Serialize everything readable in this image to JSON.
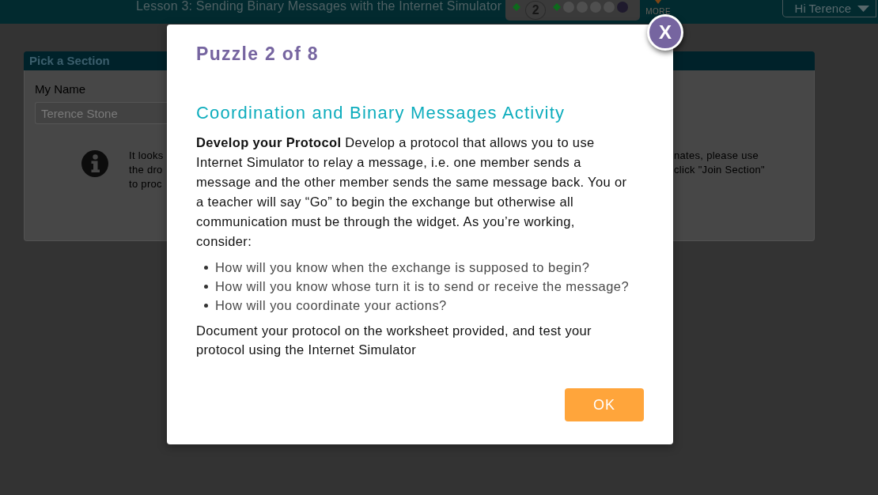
{
  "header": {
    "lesson_title": "Lesson 3: Sending Binary Messages with the Internet Simulator",
    "progress": [
      {
        "kind": "diamond",
        "color": "#0d6a1c"
      },
      {
        "kind": "bubble",
        "label": "2"
      },
      {
        "kind": "diamond",
        "color": "#0d6a1c"
      },
      {
        "kind": "dot",
        "color": "#4f4f4f"
      },
      {
        "kind": "dot",
        "color": "#4f4f4f"
      },
      {
        "kind": "dot",
        "color": "#4f4f4f"
      },
      {
        "kind": "dot",
        "color": "#4f4f4f"
      },
      {
        "kind": "dot",
        "color": "#1f1a2d"
      }
    ],
    "more_label": "MORE",
    "user_menu": "Hi Terence"
  },
  "section_card": {
    "title": "Pick a Section",
    "name_label": "My Name",
    "name_value": "Terence Stone",
    "info_text_left": [
      "It looks",
      "the dro",
      "to proc"
    ],
    "info_text_right": [
      "nates, please use",
      "click \"Join Section\""
    ]
  },
  "dialog": {
    "title": "Puzzle 2 of 8",
    "close_label": "X",
    "heading": "Coordination and Binary Messages Activity",
    "intro": "**Develop your Protocol** Develop a protocol that allows you to use Internet Simulator to relay a message, i.e. one member sends a message and the other member sends the same message back. You or a teacher will say “Go” to begin the exchange but otherwise all communication must be through the widget. As you’re working, consider:",
    "questions": [
      "How will you know when the exchange is supposed to begin?",
      "How will you know whose turn it is to send or receive the message?",
      "How will you coordinate your actions?"
    ],
    "closing": "Document your protocol on the worksheet provided, and test your protocol using the Internet Simulator",
    "ok_label": "OK"
  }
}
